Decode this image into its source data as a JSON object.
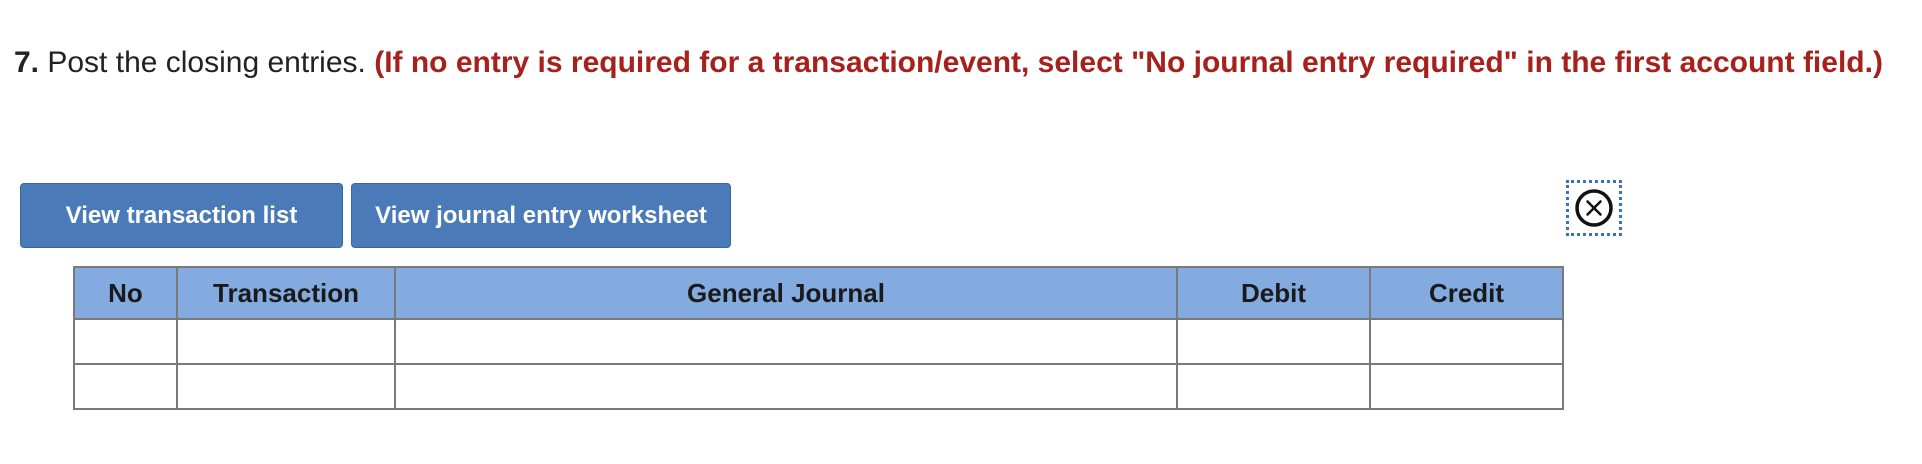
{
  "question": {
    "number": "7.",
    "text": " Post the closing entries. ",
    "instruction": "(If no entry is required for a transaction/event, select \"No journal entry required\" in the first account field.)"
  },
  "buttons": {
    "view_transaction_list": "View transaction list",
    "view_journal_entry_worksheet": "View journal entry worksheet"
  },
  "close_icon": "circle-x-icon",
  "table": {
    "headers": {
      "no": "No",
      "transaction": "Transaction",
      "general_journal": "General Journal",
      "debit": "Debit",
      "credit": "Credit"
    },
    "rows": [
      {
        "no": "",
        "transaction": "",
        "general_journal": "",
        "debit": "",
        "credit": ""
      },
      {
        "no": "",
        "transaction": "",
        "general_journal": "",
        "debit": "",
        "credit": ""
      }
    ]
  },
  "colors": {
    "instruction_red": "#a6201c",
    "button_blue": "#4a7ab8",
    "header_blue": "#83abe0",
    "focus_outline": "#3a6fc4"
  }
}
